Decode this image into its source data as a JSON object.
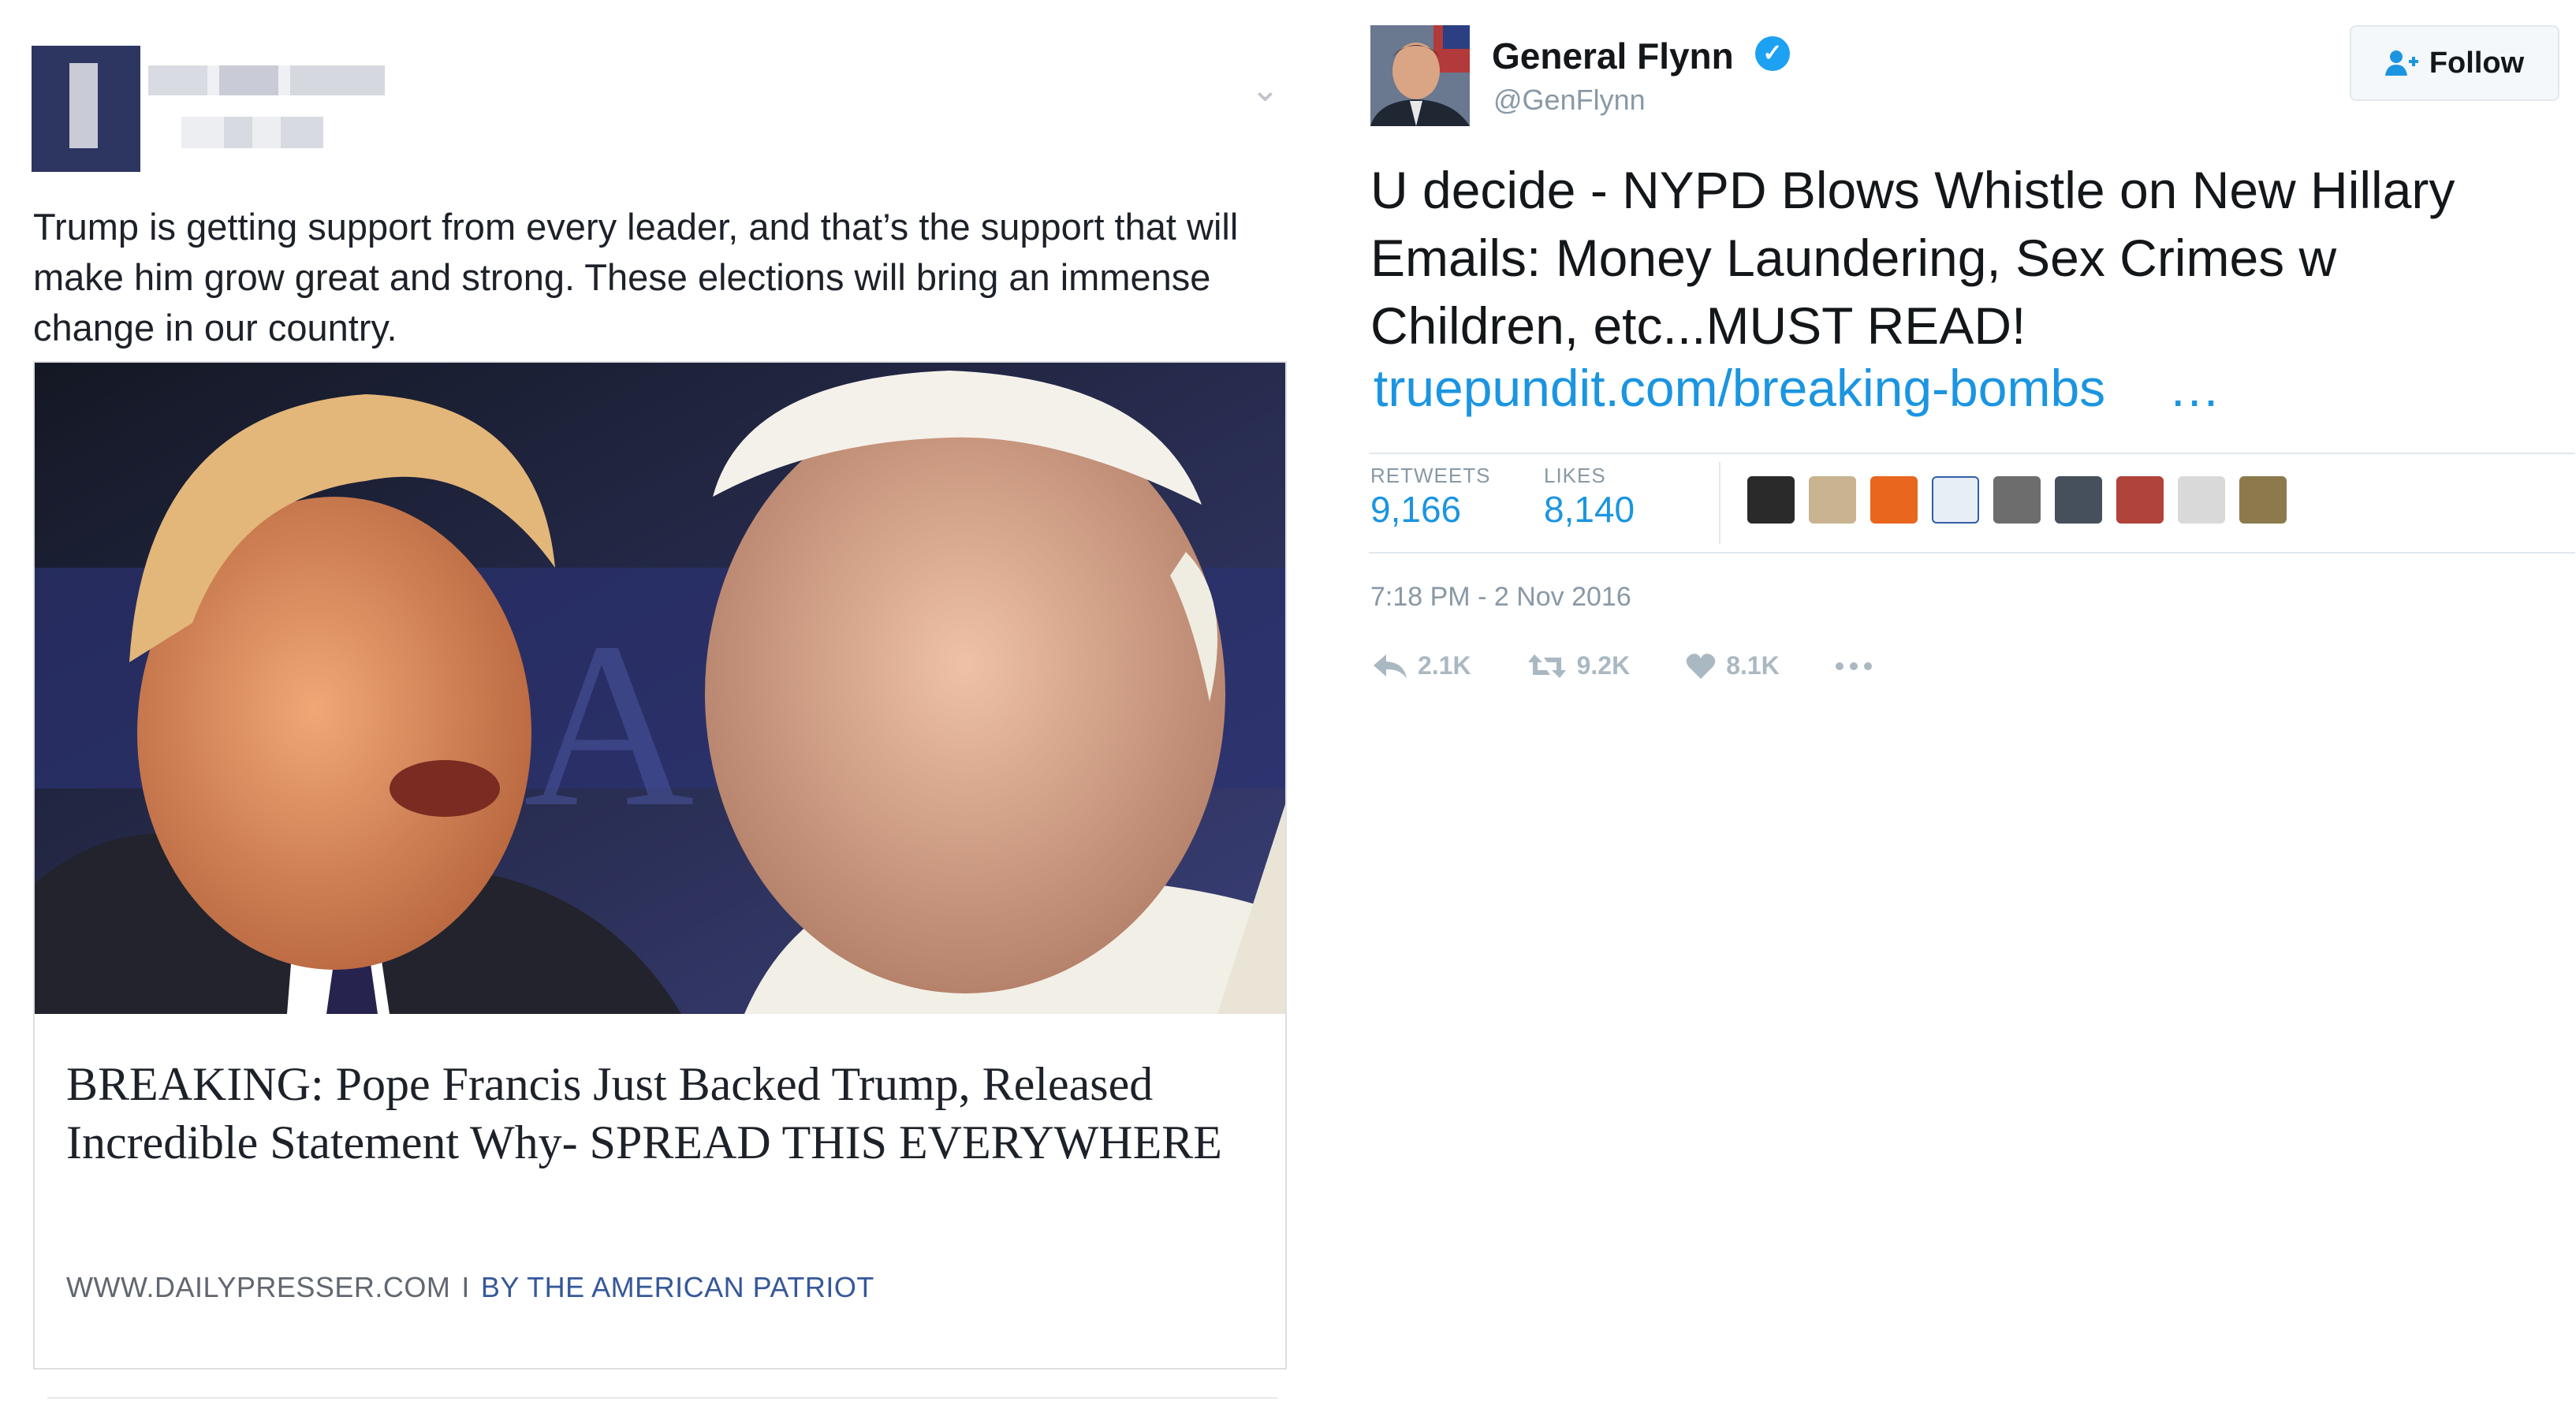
{
  "facebook_post": {
    "body_text": "Trump is getting support from every leader, and that’s the support that will make him grow great and strong. These elections will bring an immense change in our country.",
    "link_card": {
      "headline": "BREAKING: Pope Francis Just Backed Trump, Released Incredible Statement Why- SPREAD THIS EVERYWHERE",
      "domain": "WWW.DAILYPRESSER.COM",
      "separator": "I",
      "by_label": "BY",
      "author": "THE AMERICAN PATRIOT"
    },
    "icons": {
      "menu": "chevron-down-icon"
    }
  },
  "tweet": {
    "name": "General Flynn",
    "handle": "@GenFlynn",
    "follow_label": "Follow",
    "text": "U decide - NYPD Blows Whistle on New Hillary Emails: Money Laundering, Sex Crimes w Children, etc...MUST READ!",
    "link": "truepundit.com/breaking-bombs",
    "link_ellipsis": "…",
    "stats": {
      "retweets_label": "RETWEETS",
      "retweets_value": "9,166",
      "likes_label": "LIKES",
      "likes_value": "8,140"
    },
    "timestamp": "7:18 PM - 2 Nov 2016",
    "actions": {
      "reply_count": "2.1K",
      "retweet_count": "9.2K",
      "like_count": "8.1K"
    },
    "colors": {
      "link": "#1b95e0",
      "verified": "#1da1f2",
      "muted": "#8899a6"
    }
  }
}
